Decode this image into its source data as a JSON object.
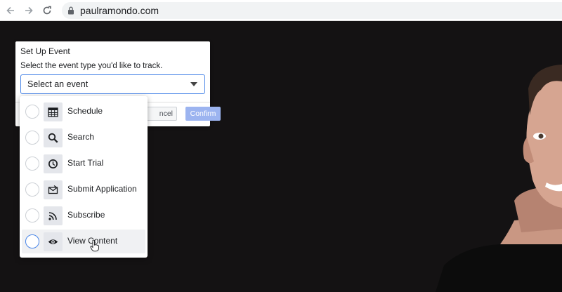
{
  "browser": {
    "url": "paulramondo.com"
  },
  "dialog": {
    "title": "Set Up Event",
    "description": "Select the event type you'd like to track.",
    "select_placeholder": "Select an event",
    "cancel_label": "ncel",
    "confirm_label": "Confirm"
  },
  "menu": {
    "items": [
      {
        "label": "Schedule",
        "icon": "calendar-icon",
        "selected": false
      },
      {
        "label": "Search",
        "icon": "search-icon",
        "selected": false
      },
      {
        "label": "Start Trial",
        "icon": "clock-icon",
        "selected": false
      },
      {
        "label": "Submit Application",
        "icon": "envelope-icon",
        "selected": false
      },
      {
        "label": "Subscribe",
        "icon": "rss-icon",
        "selected": false
      },
      {
        "label": "View Content",
        "icon": "eye-icon",
        "selected": false,
        "hovered": true
      }
    ]
  },
  "colors": {
    "accent": "#4a86e8",
    "confirm_bg": "#9cb4f0",
    "page_bg": "#141213"
  }
}
